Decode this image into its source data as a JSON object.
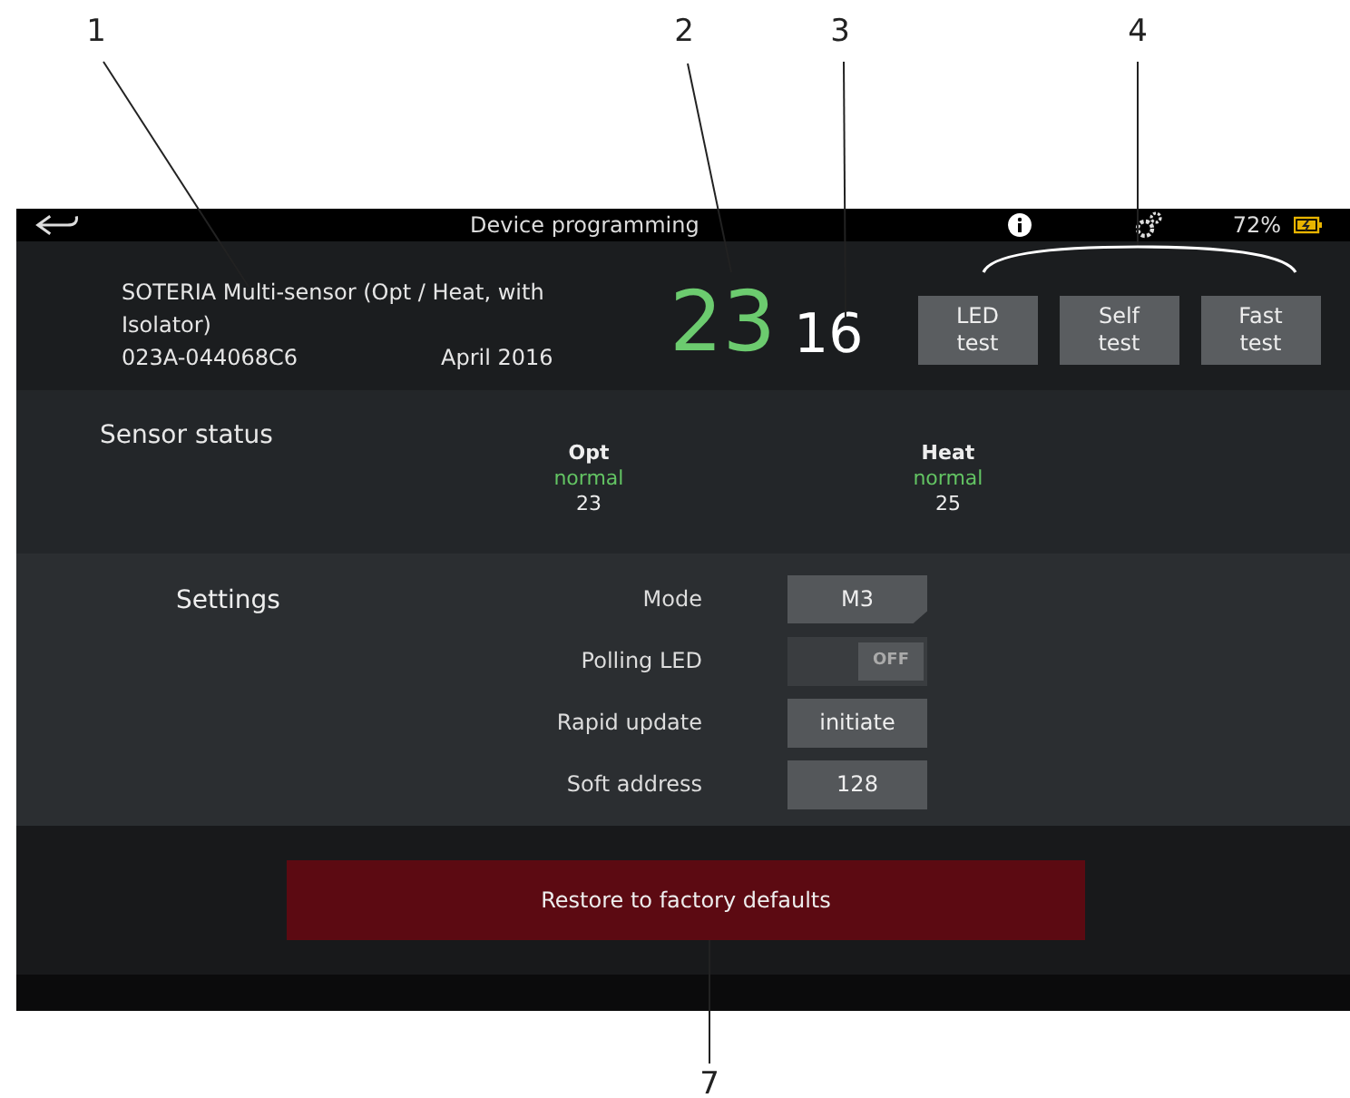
{
  "callouts": [
    {
      "label": "1"
    },
    {
      "label": "2"
    },
    {
      "label": "3"
    },
    {
      "label": "4"
    },
    {
      "label": "7"
    }
  ],
  "status_bar": {
    "title": "Device programming",
    "battery": "72%"
  },
  "device": {
    "name": "SOTERIA Multi-sensor (Opt / Heat, with Isolator)",
    "serial": "023A-044068C6",
    "date": "April 2016",
    "address": "23",
    "loop_value": "16"
  },
  "test_buttons": [
    "LED test",
    "Self test",
    "Fast test"
  ],
  "sensor_status": {
    "title": "Sensor status",
    "sensors": [
      {
        "name": "Opt",
        "state": "normal",
        "value": "23"
      },
      {
        "name": "Heat",
        "state": "normal",
        "value": "25"
      }
    ]
  },
  "settings": {
    "title": "Settings",
    "rows": [
      {
        "label": "Mode",
        "kind": "select",
        "value": "M3"
      },
      {
        "label": "Polling LED",
        "kind": "toggle",
        "on": false,
        "value": "OFF"
      },
      {
        "label": "Rapid update",
        "kind": "button",
        "value": "initiate"
      },
      {
        "label": "Soft address",
        "kind": "button",
        "value": "128"
      }
    ]
  },
  "restore_button": "Restore to factory defaults"
}
